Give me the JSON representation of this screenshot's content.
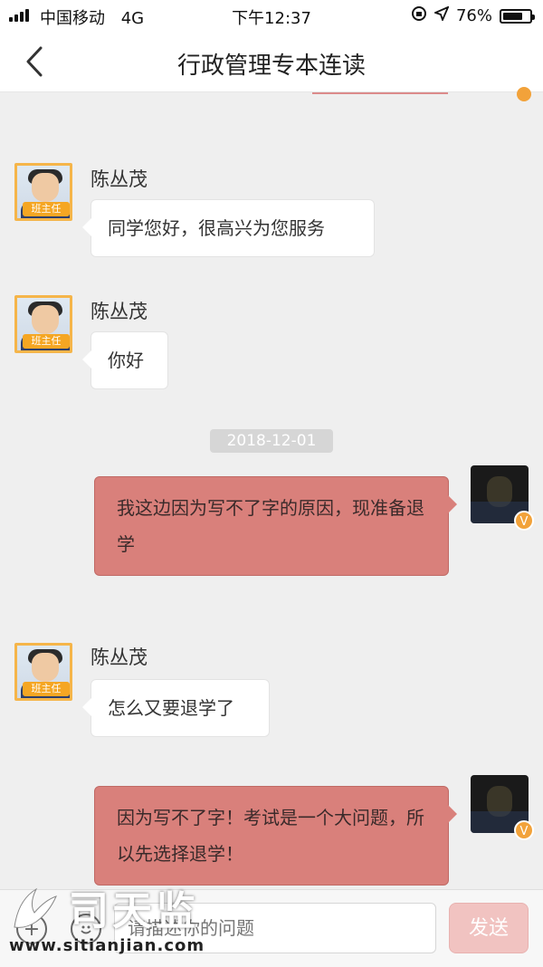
{
  "status_bar": {
    "carrier": "中国移动",
    "network": "4G",
    "time": "下午12:37",
    "battery": "76%",
    "battery_level": 0.76
  },
  "nav": {
    "title": "行政管理专本连读"
  },
  "messages": [
    {
      "sender": "陈丛茂",
      "role_tag": "班主任",
      "text": "同学您好，很高兴为您服务"
    },
    {
      "sender": "陈丛茂",
      "role_tag": "班主任",
      "text": "你好"
    },
    {
      "timestamp": "2018-12-01"
    },
    {
      "me": true,
      "text": "我这边因为写不了字的原因，现准备退学",
      "badge": "V"
    },
    {
      "sender": "陈丛茂",
      "role_tag": "班主任",
      "text": "怎么又要退学了"
    },
    {
      "me": true,
      "text": "因为写不了字！考试是一个大问题，所以先选择退学！",
      "badge": "V"
    }
  ],
  "input_bar": {
    "placeholder": "请描述你的问题",
    "send_label": "发送"
  },
  "watermark": {
    "title": "司天监",
    "url": "www.sitianjian.com"
  },
  "colors": {
    "accent": "#f5a623",
    "my_bubble": "#d9807b",
    "send_button": "#f1c3c1"
  }
}
